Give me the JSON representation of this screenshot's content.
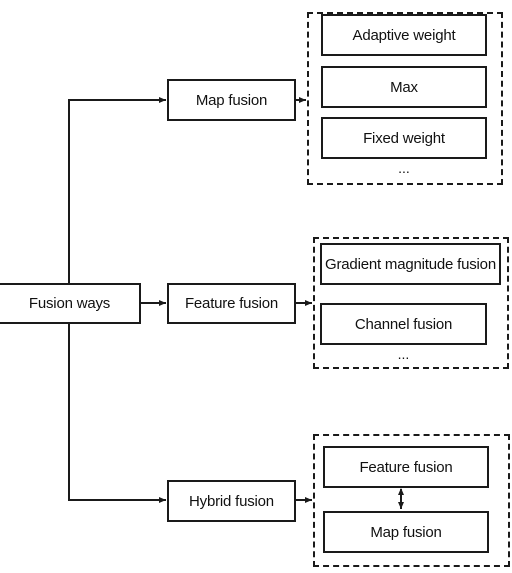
{
  "root": {
    "label": "Fusion ways"
  },
  "branches": [
    {
      "label": "Map fusion",
      "group": {
        "items": [
          "Adaptive weight",
          "Max",
          "Fixed weight"
        ],
        "ellipsis": "..."
      }
    },
    {
      "label": "Feature fusion",
      "group": {
        "items": [
          "Gradient magnitude fusion",
          "Channel fusion"
        ],
        "ellipsis": "..."
      }
    },
    {
      "label": "Hybrid fusion",
      "group": {
        "items": [
          "Feature fusion",
          "Map fusion"
        ],
        "relation": "bidirectional"
      }
    }
  ]
}
